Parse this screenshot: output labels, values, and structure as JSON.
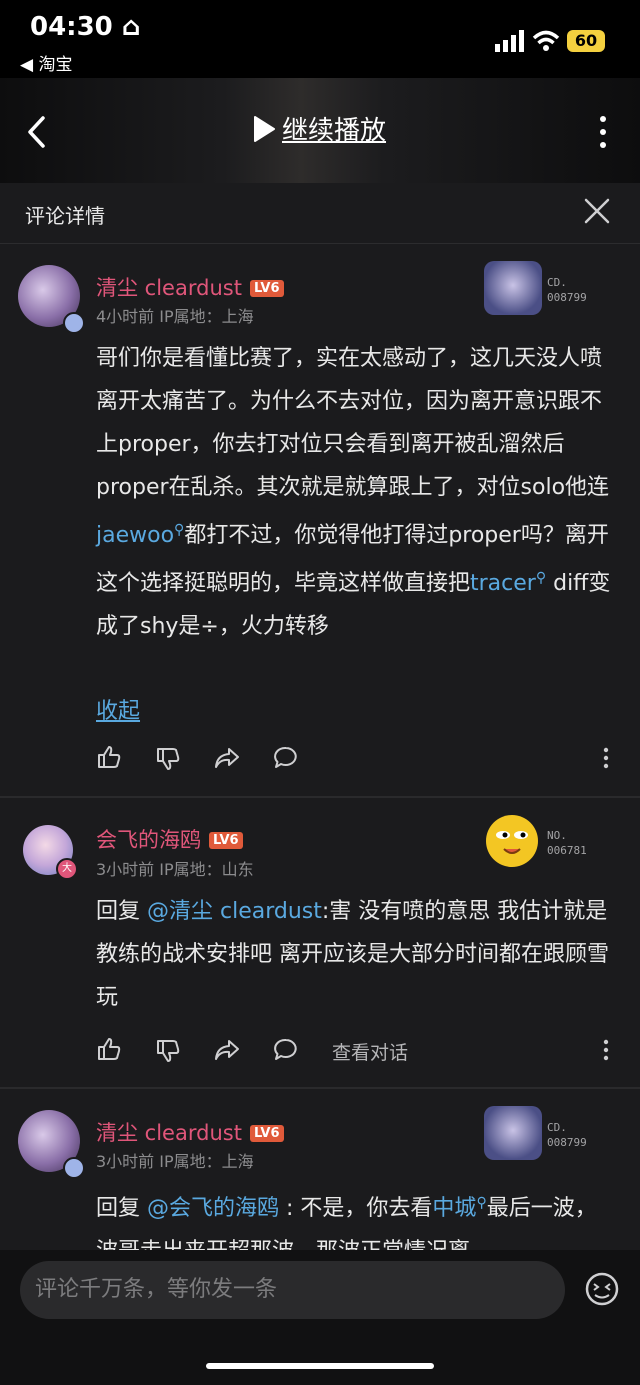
{
  "status": {
    "time": "04:30",
    "back_app": "◀ 淘宝",
    "battery": "60"
  },
  "header": {
    "continue_label": "继续播放"
  },
  "section": {
    "title": "评论详情"
  },
  "comments": [
    {
      "user": "清尘 cleardust",
      "level": "LV6",
      "meta": "4小时前  IP属地：上海",
      "medal_top": "CD.",
      "medal_bottom": "008799",
      "text": [
        {
          "t": "哥们你是看懂比赛了，实在太感动了，这几天没人喷离开太痛苦了。为什么不去对位，因为离开意识跟不上proper，你去打对位只会看到离开被乱溜然后proper在乱杀。其次就是就算跟上了，对位solo他连"
        },
        {
          "k": "jaewoo"
        },
        {
          "t": "都打不过，你觉得他打得过proper吗？离开这个选择挺聪明的，毕竟这样做直接把"
        },
        {
          "k": "tracer"
        },
        {
          "t": " diff变成了shy是÷，火力转移"
        }
      ],
      "collapse": "收起"
    },
    {
      "user": "会飞的海鸥",
      "level": "LV6",
      "meta": "3小时前  IP属地：山东",
      "medal_top": "NO.",
      "medal_bottom": "006781",
      "reply_prefix": "回复 ",
      "reply_to": "@清尘 cleardust",
      "text": ":害 没有喷的意思 我估计就是教练的战术安排吧 离开应该是大部分时间都在跟顾雪玩",
      "view_conv": "查看对话"
    },
    {
      "user": "清尘 cleardust",
      "level": "LV6",
      "meta": "3小时前  IP属地：上海",
      "medal_top": "CD.",
      "medal_bottom": "008799",
      "reply_prefix": "回复 ",
      "reply_to": "@会飞的海鸥",
      "text_a": " : 不是，你去看",
      "kw": "中城",
      "text_b": "最后一波，波哥走出来开超那波，那波正常情况离"
    }
  ],
  "input": {
    "placeholder": "评论千万条，等你发一条"
  },
  "colors": {
    "username": "#e0567a",
    "mention": "#5aa9e0",
    "level_badge": "#e05a3a",
    "battery": "#f4d03f"
  }
}
